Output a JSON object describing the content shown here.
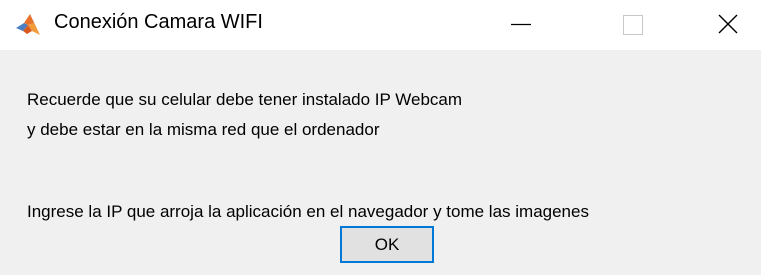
{
  "window": {
    "title": "Conexión Camara WIFI",
    "app_icon": "matlab-icon",
    "controls": {
      "minimize_icon": "minimize-icon",
      "maximize_icon": "maximize-icon",
      "close_icon": "close-icon"
    }
  },
  "dialog": {
    "lines": [
      "Recuerde que su celular debe tener instalado IP Webcam",
      "y debe estar en la misma red que el ordenador",
      "Ingrese la IP que arroja la aplicación en el navegador y tome las imagenes"
    ],
    "ok_label": "OK"
  },
  "colors": {
    "titlebar": "#ffffff",
    "body": "#f0f0f0",
    "button_face": "#e1e1e1",
    "button_focus_border": "#0078d7"
  }
}
